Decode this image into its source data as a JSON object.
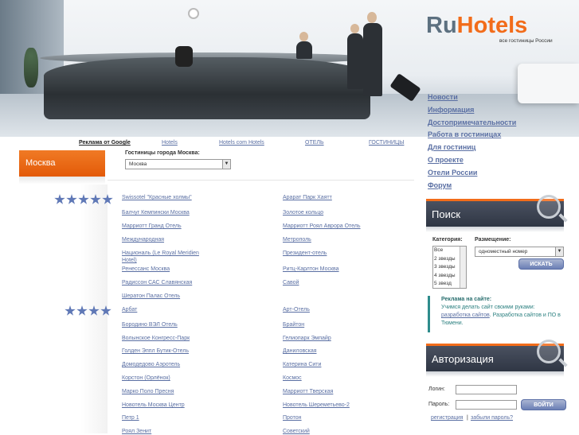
{
  "site": {
    "logo_left": "Ru",
    "logo_right": "Hotels",
    "slogan": "все гостиницы России"
  },
  "right_nav": [
    "Новости",
    "Информация",
    "Достопримечательности",
    "Работа в гостиницах",
    "Для гостиниц",
    "О проекте",
    "Отели России",
    "Форум"
  ],
  "ads_bar": [
    "Реклама от Google",
    "Hotels",
    "Hotels com Hotels",
    "ОТЕЛЬ",
    "ГОСТИНИЦЫ"
  ],
  "city": {
    "name": "Москва",
    "select_label": "Гостиницы города Москва:",
    "select_value": "Москва"
  },
  "hotels": {
    "five_star_left": [
      "Swissotel \"Красные холмы\"",
      "Балчуг Кемпински Москва",
      "Марриотт Гранд Отель",
      "Международная",
      "Националь (Le Royal Meridien Hotel)",
      "Ренессанс Москва",
      "Радиссон САС Славянская",
      "Шератон Палас Отель"
    ],
    "five_star_right": [
      "Арарат Парк Хаятт",
      "Золотое кольцо",
      "Марриотт Роял Аврора Отель",
      "Метрополь",
      "Президент-отель",
      "Ритц-Карлтон Москва",
      "Савой"
    ],
    "four_star_left": [
      "Арбат",
      "Бородино ВЭЛ Отель",
      "Волынское Конгресс-Парк",
      "Голден Эппл Бутик-Отель",
      "Домодедово Аэротель",
      "Корстон (Орлёнок)",
      "Марко Поло Пресня",
      "Новотель Москва Центр",
      "Петр 1",
      "Роял Зенит"
    ],
    "four_star_right": [
      "Арт-Отель",
      "Брайтон",
      "Гелиопарк Эмпайр",
      "Даниловская",
      "Катерина Сити",
      "Космос",
      "Марриотт Тверская",
      "Новотель Шереметьево-2",
      "Протон",
      "Советский"
    ]
  },
  "stars": {
    "first_group": 5,
    "second_group": 4
  },
  "search": {
    "title": "Поиск",
    "category_label": "Категория:",
    "placement_label": "Размещение:",
    "categories": [
      "Все",
      "2 звезды",
      "3 звезды",
      "4 звезды",
      "5 звезд"
    ],
    "placement_value": "одноместный номер",
    "button": "ИСКАТЬ"
  },
  "ad": {
    "title": "Реклама на сайте:",
    "text1": "Учимся делать сайт своими руками:",
    "link": "разработка сайтов",
    "text2": ". Разработка сайтов и ПО в Тюмени."
  },
  "auth": {
    "title": "Авторизация",
    "login_label": "Логин:",
    "password_label": "Пароль:",
    "button": "ВОЙТИ",
    "register": "регистрация",
    "forgot": "забыли пароль?"
  },
  "colors": {
    "accent": "#f26c1a",
    "link": "#5a6fa3",
    "panel": "#3a4150",
    "star": "#5f78b6"
  }
}
